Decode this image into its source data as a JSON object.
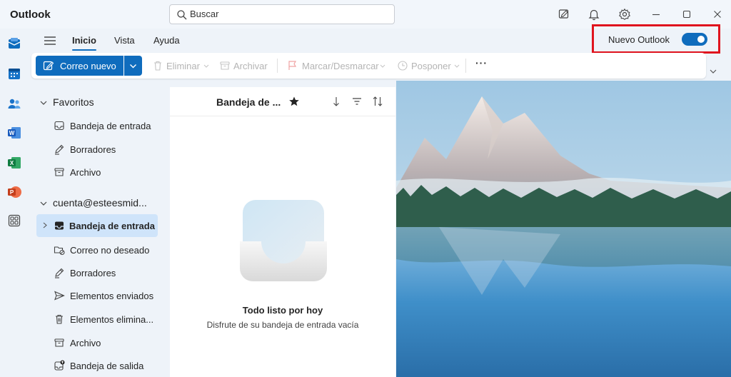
{
  "window": {
    "title": "Outlook"
  },
  "search": {
    "placeholder": "Buscar"
  },
  "ribbon": {
    "tabs": [
      {
        "label": "Inicio",
        "active": true
      },
      {
        "label": "Vista",
        "active": false
      },
      {
        "label": "Ayuda",
        "active": false
      }
    ],
    "toggle": {
      "label": "Nuevo Outlook",
      "on": true
    },
    "commands": {
      "new_mail": "Correo nuevo",
      "delete": "Eliminar",
      "archive": "Archivar",
      "flag": "Marcar/Desmarcar",
      "snooze": "Posponer",
      "more": "···"
    }
  },
  "rail": {
    "icons": [
      "mail-icon",
      "calendar-icon",
      "people-icon",
      "word-icon",
      "excel-icon",
      "powerpoint-icon",
      "apps-icon"
    ]
  },
  "folders": {
    "favorites": {
      "label": "Favoritos",
      "items": [
        {
          "label": "Bandeja de entrada",
          "icon": "inbox-icon"
        },
        {
          "label": "Borradores",
          "icon": "pencil-icon"
        },
        {
          "label": "Archivo",
          "icon": "archive-icon"
        }
      ]
    },
    "account": {
      "label": "cuenta@esteesmid...",
      "items": [
        {
          "label": "Bandeja de entrada",
          "icon": "inbox-icon",
          "selected": true
        },
        {
          "label": "Correo no deseado",
          "icon": "junk-icon"
        },
        {
          "label": "Borradores",
          "icon": "pencil-icon"
        },
        {
          "label": "Elementos enviados",
          "icon": "send-icon"
        },
        {
          "label": "Elementos elimina...",
          "icon": "trash-icon"
        },
        {
          "label": "Archivo",
          "icon": "archive-icon"
        },
        {
          "label": "Bandeja de salida",
          "icon": "outbox-icon"
        }
      ]
    }
  },
  "message_list": {
    "title": "Bandeja de ...",
    "empty_title": "Todo listo por hoy",
    "empty_subtitle": "Disfrute de su bandeja de entrada vacía"
  },
  "colors": {
    "accent": "#0f6cbd",
    "highlight": "#e0141e",
    "selected": "#cfe4fa"
  }
}
